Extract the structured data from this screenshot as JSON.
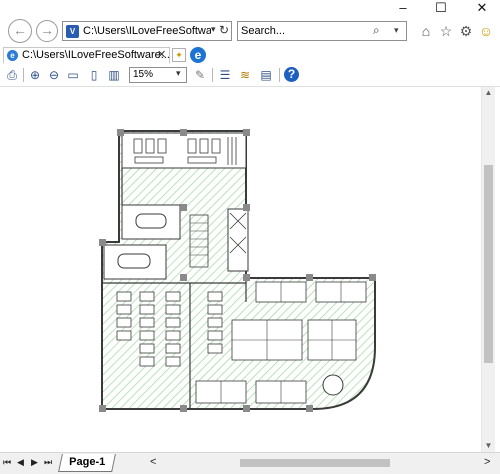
{
  "window": {
    "minimize": "–",
    "maximize": "☐",
    "close": "✕"
  },
  "nav": {
    "back_glyph": "←",
    "forward_glyph": "→"
  },
  "address": {
    "favicon_glyph": "V",
    "url": "C:\\Users\\ILoveFreeSoftwa",
    "dropdown_glyph": "▾",
    "refresh_glyph": "↻"
  },
  "search": {
    "placeholder": "Search...",
    "icon_glyph": "⌕",
    "dropdown_glyph": "▾"
  },
  "right_icons": {
    "home": "⌂",
    "favorites": "☆",
    "settings": "⚙",
    "smiley": "☺"
  },
  "tab": {
    "icon_glyph": "e",
    "label": "C:\\Users\\ILoveFreeSoftware...",
    "close": "✕"
  },
  "toolbar": {
    "print_glyph": "⎙",
    "zoom_in_glyph": "⊕",
    "zoom_out_glyph": "⊖",
    "page_glyph": "▭",
    "fit_glyph": "▯",
    "fit_width_glyph": "▥",
    "zoom_value": "15%",
    "zoom_dropdown_glyph": "▾",
    "pan_glyph": "✎",
    "layers_glyph": "☰",
    "layers2_glyph": "≋",
    "panel_glyph": "▤",
    "help_glyph": "?"
  },
  "statusbar": {
    "first": "⏮",
    "prev": "◀",
    "next": "▶",
    "last": "⏭",
    "page_tab": "Page-1",
    "scroll_left": "<",
    "scroll_right": ">"
  },
  "scroll": {
    "up": "▲",
    "down": "▼"
  },
  "colors": {
    "hatch": "#9fd3a0",
    "wall": "#3a3a3a",
    "thumb": "#c2c2c2"
  }
}
